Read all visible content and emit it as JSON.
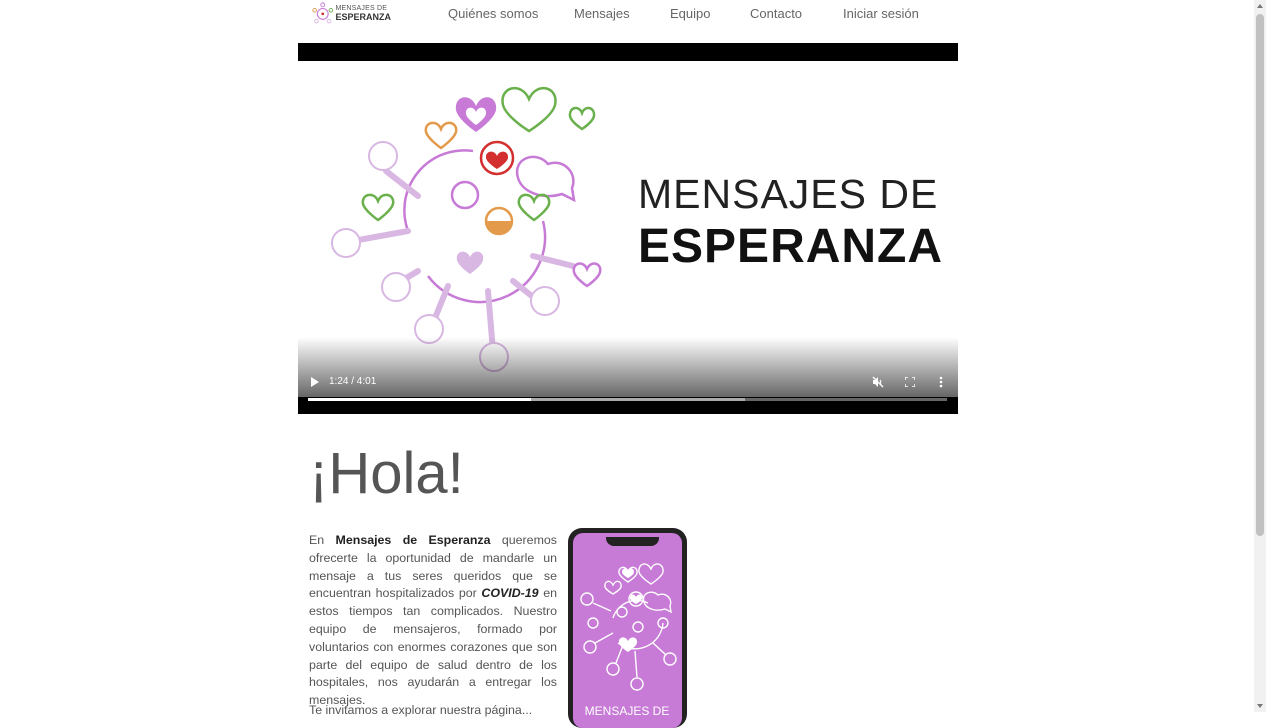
{
  "header": {
    "logo": {
      "line1": "MENSAJES DE",
      "line2": "ESPERANZA"
    },
    "nav": [
      {
        "label": "Quiénes somos"
      },
      {
        "label": "Mensajes"
      },
      {
        "label": "Equipo"
      },
      {
        "label": "Contacto"
      },
      {
        "label": "Iniciar sesión"
      }
    ]
  },
  "video": {
    "title_line1": "MENSAJES DE",
    "title_line2": "ESPERANZA",
    "time": "1:24 / 4:01",
    "progress_played": 0.349,
    "progress_buffered": 0.684,
    "icons": [
      "play-icon",
      "mute-icon",
      "fullscreen-icon",
      "more-options-icon"
    ]
  },
  "content": {
    "heading": "¡Hola!",
    "para_parts": {
      "p1": "En ",
      "brand": "Mensajes de Esperanza",
      "p2": " queremos ofrecerte la oportunidad de mandarle un mensaje a tus seres queridos que se encuentran hospitalizados por ",
      "covid": "COVID-19",
      "p3": " en estos tiempos tan complicados. Nuestro equipo de mensajeros, formado por voluntarios con enormes corazones que son parte del equipo de salud dentro de los hospitales, nos ayudarán a entregar los mensajes."
    },
    "para2": "Te invitamos a explorar nuestra página...",
    "phone_text": "MENSAJES DE"
  },
  "colors": {
    "accent_purple": "#c77ad6",
    "heart_green": "#6ab04c",
    "heart_red": "#d32f2f",
    "heart_orange": "#e39a4a",
    "virus_lilac": "#d9b7e3"
  }
}
